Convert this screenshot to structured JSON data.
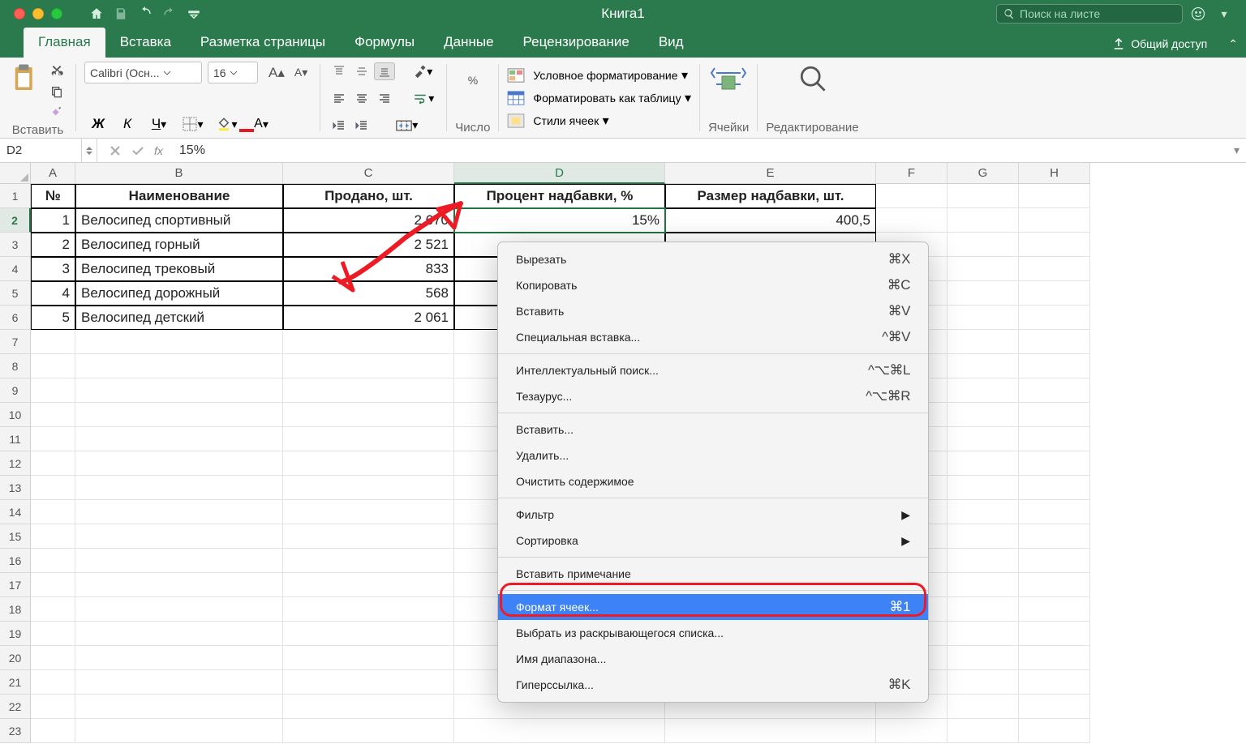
{
  "title": "Книга1",
  "search": {
    "placeholder": "Поиск на листе"
  },
  "tabs": {
    "home": "Главная",
    "insert": "Вставка",
    "layout": "Разметка страницы",
    "formulas": "Формулы",
    "data": "Данные",
    "review": "Рецензирование",
    "view": "Вид",
    "share": "Общий доступ"
  },
  "ribbon": {
    "paste": "Вставить",
    "font_name": "Calibri (Осн...",
    "font_size": "16",
    "number": "Число",
    "cond_fmt": "Условное форматирование",
    "as_table": "Форматировать как таблицу",
    "cell_styles": "Стили ячеек",
    "cells": "Ячейки",
    "editing": "Редактирование"
  },
  "namebox": "D2",
  "formula_value": "15%",
  "cols": {
    "A": "A",
    "B": "B",
    "C": "C",
    "D": "D",
    "E": "E",
    "F": "F",
    "G": "G",
    "H": "H"
  },
  "headers": {
    "no": "№",
    "name": "Наименование",
    "sold": "Продано, шт.",
    "markup_pct": "Процент надбавки, %",
    "markup_sz": "Размер надбавки, шт."
  },
  "rows": [
    {
      "no": "1",
      "name": "Велосипед спортивный",
      "sold": "2 670",
      "pct": "15%",
      "sz": "400,5"
    },
    {
      "no": "2",
      "name": "Велосипед горный",
      "sold": "2 521",
      "pct": "",
      "sz": ""
    },
    {
      "no": "3",
      "name": "Велосипед трековый",
      "sold": "833",
      "pct": "",
      "sz": ""
    },
    {
      "no": "4",
      "name": "Велосипед дорожный",
      "sold": "568",
      "pct": "",
      "sz": ""
    },
    {
      "no": "5",
      "name": "Велосипед детский",
      "sold": "2 061",
      "pct": "",
      "sz": ""
    }
  ],
  "context_menu": {
    "cut": {
      "label": "Вырезать",
      "sc": "⌘X"
    },
    "copy": {
      "label": "Копировать",
      "sc": "⌘C"
    },
    "paste": {
      "label": "Вставить",
      "sc": "⌘V"
    },
    "paste_special": {
      "label": "Специальная вставка...",
      "sc": "^⌘V"
    },
    "smart_lookup": {
      "label": "Интеллектуальный поиск...",
      "sc": "^⌥⌘L"
    },
    "thesaurus": {
      "label": "Тезаурус...",
      "sc": "^⌥⌘R"
    },
    "insert": {
      "label": "Вставить..."
    },
    "delete": {
      "label": "Удалить..."
    },
    "clear": {
      "label": "Очистить содержимое"
    },
    "filter": {
      "label": "Фильтр"
    },
    "sort": {
      "label": "Сортировка"
    },
    "comment": {
      "label": "Вставить примечание"
    },
    "format_cells": {
      "label": "Формат ячеек...",
      "sc": "⌘1"
    },
    "pick_list": {
      "label": "Выбрать из раскрывающегося списка..."
    },
    "name_range": {
      "label": "Имя диапазона..."
    },
    "hyperlink": {
      "label": "Гиперссылка...",
      "sc": "⌘K"
    }
  }
}
